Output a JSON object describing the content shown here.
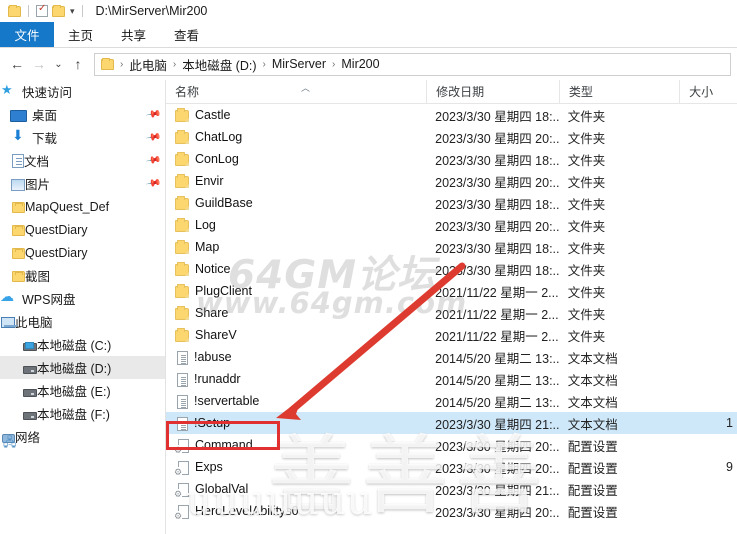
{
  "window": {
    "titlebar_path": "D:\\MirServer\\Mir200",
    "qat": [
      {
        "name": "folder-icon",
        "label": ""
      },
      {
        "name": "properties-icon",
        "label": ""
      },
      {
        "name": "new-folder-icon",
        "label": ""
      },
      {
        "name": "chevron-down-icon",
        "label": "▾"
      }
    ]
  },
  "ribbon": {
    "tabs": [
      {
        "label": "文件",
        "active": true
      },
      {
        "label": "主页",
        "active": false
      },
      {
        "label": "共享",
        "active": false
      },
      {
        "label": "查看",
        "active": false
      }
    ]
  },
  "navbar": {
    "back": "←",
    "forward": "→",
    "recent": "⌄",
    "up": "↑",
    "breadcrumbs": [
      "此电脑",
      "本地磁盘 (D:)",
      "MirServer",
      "Mir200"
    ],
    "separator": "›"
  },
  "sidebar": {
    "items": [
      {
        "label": "快速访问",
        "icon": "star-icon",
        "indent": 0,
        "pinned": false,
        "selected": false
      },
      {
        "label": "桌面",
        "icon": "desktop-icon",
        "indent": 1,
        "pinned": true,
        "selected": false
      },
      {
        "label": "下载",
        "icon": "download-icon",
        "indent": 1,
        "pinned": true,
        "selected": false
      },
      {
        "label": "文档",
        "icon": "documents-icon",
        "indent": 1,
        "pinned": true,
        "selected": false
      },
      {
        "label": "图片",
        "icon": "pictures-icon",
        "indent": 1,
        "pinned": true,
        "selected": false
      },
      {
        "label": "MapQuest_Def",
        "icon": "folder-icon",
        "indent": 1,
        "pinned": false,
        "selected": false
      },
      {
        "label": "QuestDiary",
        "icon": "folder-icon",
        "indent": 1,
        "pinned": false,
        "selected": false
      },
      {
        "label": "QuestDiary",
        "icon": "folder-icon",
        "indent": 1,
        "pinned": false,
        "selected": false
      },
      {
        "label": "截图",
        "icon": "folder-icon",
        "indent": 1,
        "pinned": false,
        "selected": false
      },
      {
        "label": "WPS网盘",
        "icon": "cloud-icon",
        "indent": 0,
        "pinned": false,
        "selected": false
      },
      {
        "label": "此电脑",
        "icon": "computer-icon",
        "indent": 0,
        "pinned": false,
        "selected": false
      },
      {
        "label": "本地磁盘 (C:)",
        "icon": "system-drive-icon",
        "indent": 2,
        "pinned": false,
        "selected": false
      },
      {
        "label": "本地磁盘 (D:)",
        "icon": "drive-icon",
        "indent": 2,
        "pinned": false,
        "selected": true
      },
      {
        "label": "本地磁盘 (E:)",
        "icon": "drive-icon",
        "indent": 2,
        "pinned": false,
        "selected": false
      },
      {
        "label": "本地磁盘 (F:)",
        "icon": "drive-icon",
        "indent": 2,
        "pinned": false,
        "selected": false
      },
      {
        "label": "网络",
        "icon": "network-icon",
        "indent": 0,
        "pinned": false,
        "selected": false
      }
    ],
    "pin_glyph": "📌"
  },
  "filelist": {
    "columns": [
      {
        "label": "名称",
        "key": "name"
      },
      {
        "label": "修改日期",
        "key": "date"
      },
      {
        "label": "类型",
        "key": "type"
      },
      {
        "label": "大小",
        "key": "size"
      }
    ],
    "sort_caret": "︿",
    "rows": [
      {
        "name": "Castle",
        "date": "2023/3/30 星期四 18:...",
        "type": "文件夹",
        "size": "",
        "icon": "folder-icon",
        "selected": false
      },
      {
        "name": "ChatLog",
        "date": "2023/3/30 星期四 20:...",
        "type": "文件夹",
        "size": "",
        "icon": "folder-icon",
        "selected": false
      },
      {
        "name": "ConLog",
        "date": "2023/3/30 星期四 18:...",
        "type": "文件夹",
        "size": "",
        "icon": "folder-icon",
        "selected": false
      },
      {
        "name": "Envir",
        "date": "2023/3/30 星期四 20:...",
        "type": "文件夹",
        "size": "",
        "icon": "folder-icon",
        "selected": false
      },
      {
        "name": "GuildBase",
        "date": "2023/3/30 星期四 18:...",
        "type": "文件夹",
        "size": "",
        "icon": "folder-icon",
        "selected": false
      },
      {
        "name": "Log",
        "date": "2023/3/30 星期四 20:...",
        "type": "文件夹",
        "size": "",
        "icon": "folder-icon",
        "selected": false
      },
      {
        "name": "Map",
        "date": "2023/3/30 星期四 18:...",
        "type": "文件夹",
        "size": "",
        "icon": "folder-icon",
        "selected": false
      },
      {
        "name": "Notice",
        "date": "2023/3/30 星期四 18:...",
        "type": "文件夹",
        "size": "",
        "icon": "folder-icon",
        "selected": false
      },
      {
        "name": "PlugClient",
        "date": "2021/11/22 星期一 2...",
        "type": "文件夹",
        "size": "",
        "icon": "folder-icon",
        "selected": false
      },
      {
        "name": "Share",
        "date": "2021/11/22 星期一 2...",
        "type": "文件夹",
        "size": "",
        "icon": "folder-icon",
        "selected": false
      },
      {
        "name": "ShareV",
        "date": "2021/11/22 星期一 2...",
        "type": "文件夹",
        "size": "",
        "icon": "folder-icon",
        "selected": false
      },
      {
        "name": "!abuse",
        "date": "2014/5/20 星期二 13:...",
        "type": "文本文档",
        "size": "",
        "icon": "text-file-icon",
        "selected": false
      },
      {
        "name": "!runaddr",
        "date": "2014/5/20 星期二 13:...",
        "type": "文本文档",
        "size": "",
        "icon": "text-file-icon",
        "selected": false
      },
      {
        "name": "!servertable",
        "date": "2014/5/20 星期二 13:...",
        "type": "文本文档",
        "size": "",
        "icon": "text-file-icon",
        "selected": false
      },
      {
        "name": "!Setup",
        "date": "2023/3/30 星期四 21:...",
        "type": "文本文档",
        "size": "1",
        "icon": "text-file-icon",
        "selected": true
      },
      {
        "name": "Command",
        "date": "2023/3/30 星期四 20:...",
        "type": "配置设置",
        "size": "",
        "icon": "config-file-icon",
        "selected": false
      },
      {
        "name": "Exps",
        "date": "2023/3/30 星期四 20:...",
        "type": "配置设置",
        "size": "9",
        "icon": "config-file-icon",
        "selected": false
      },
      {
        "name": "GlobalVal",
        "date": "2023/3/30 星期四 21:...",
        "type": "配置设置",
        "size": "",
        "icon": "config-file-icon",
        "selected": false
      },
      {
        "name": "HeroLevelAbilitys0",
        "date": "2023/3/30 星期四 20:...",
        "type": "配置设置",
        "size": "",
        "icon": "config-file-icon",
        "selected": false
      }
    ]
  },
  "watermarks": {
    "forum_line1": "64GM论坛",
    "forum_line2": "www.64gm.com",
    "cursive_main": "善善善",
    "cursive_sub": "uuuuuuu"
  },
  "annotation": {
    "highlight_target": "!Setup",
    "color": "#e03030"
  }
}
